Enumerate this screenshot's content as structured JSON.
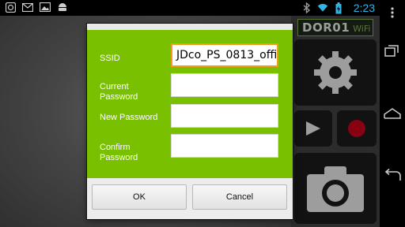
{
  "status_bar": {
    "time": "2:23",
    "left_icons": [
      "image-icon",
      "gmail-icon",
      "picture-icon",
      "android-icon"
    ],
    "right_icons": [
      "bluetooth-icon",
      "wifi-icon",
      "battery-charging-icon"
    ],
    "accent_color": "#33b5e5"
  },
  "app_panel": {
    "title": "DOR01",
    "subtitle": "WiFi",
    "buttons": [
      "gear-icon",
      "play-icon",
      "record-icon",
      "camera-icon"
    ]
  },
  "dialog": {
    "fields": [
      {
        "label": "SSID",
        "value": "JDco_PS_0813_offi"
      },
      {
        "label": "Current Password",
        "value": ""
      },
      {
        "label": "New Password",
        "value": ""
      },
      {
        "label": "Confirm Password",
        "value": ""
      }
    ],
    "ok_label": "OK",
    "cancel_label": "Cancel",
    "form_color": "#79c000",
    "focus_color": "#f29a1a"
  },
  "nav_bar": {
    "buttons": [
      "menu-icon",
      "recent-apps-icon",
      "home-icon",
      "back-icon"
    ]
  }
}
